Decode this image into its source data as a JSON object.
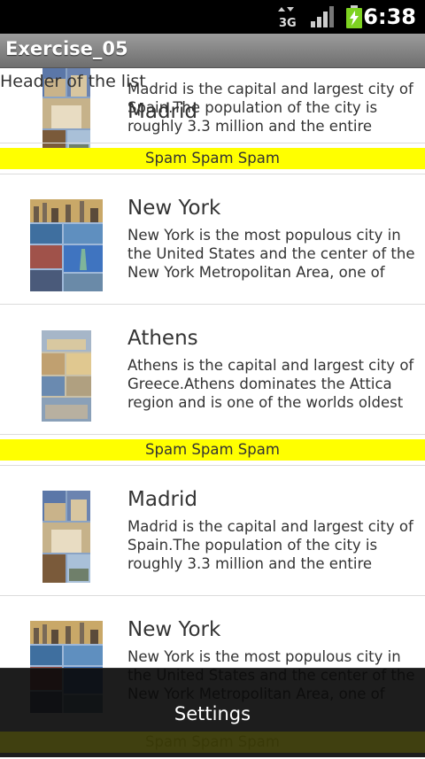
{
  "status_bar": {
    "network": "3G",
    "time": "6:38",
    "icons": [
      "3g-data-icon",
      "signal-icon",
      "battery-charging-icon"
    ]
  },
  "app": {
    "title": "Exercise_05"
  },
  "list": {
    "header": "Header of the list",
    "spam_label": "Spam Spam Spam",
    "items": [
      {
        "name": "Madrid",
        "description": "Madrid is the capital and largest city of Spain.The population of the city is roughly 3.3 million and the entire"
      },
      {
        "name": "New York",
        "description": "New York is the most populous city in the United States and the center of the New York Metropolitan Area, one of"
      },
      {
        "name": "Athens",
        "description": "Athens is the capital and largest city of Greece.Athens dominates the Attica region and is one of the worlds oldest"
      },
      {
        "name": "Madrid",
        "description": "Madrid is the capital and largest city of Spain.The population of the city is roughly 3.3 million and the entire"
      },
      {
        "name": "New York",
        "description": "New York is the most populous city in the United States and the center of the New York Metropolitan Area, one of"
      }
    ]
  },
  "menu": {
    "settings": "Settings"
  },
  "colors": {
    "spam_bg": "#ffff00",
    "menu_bg": "#0a0a0a",
    "title_bar": "#8a8a8a"
  }
}
